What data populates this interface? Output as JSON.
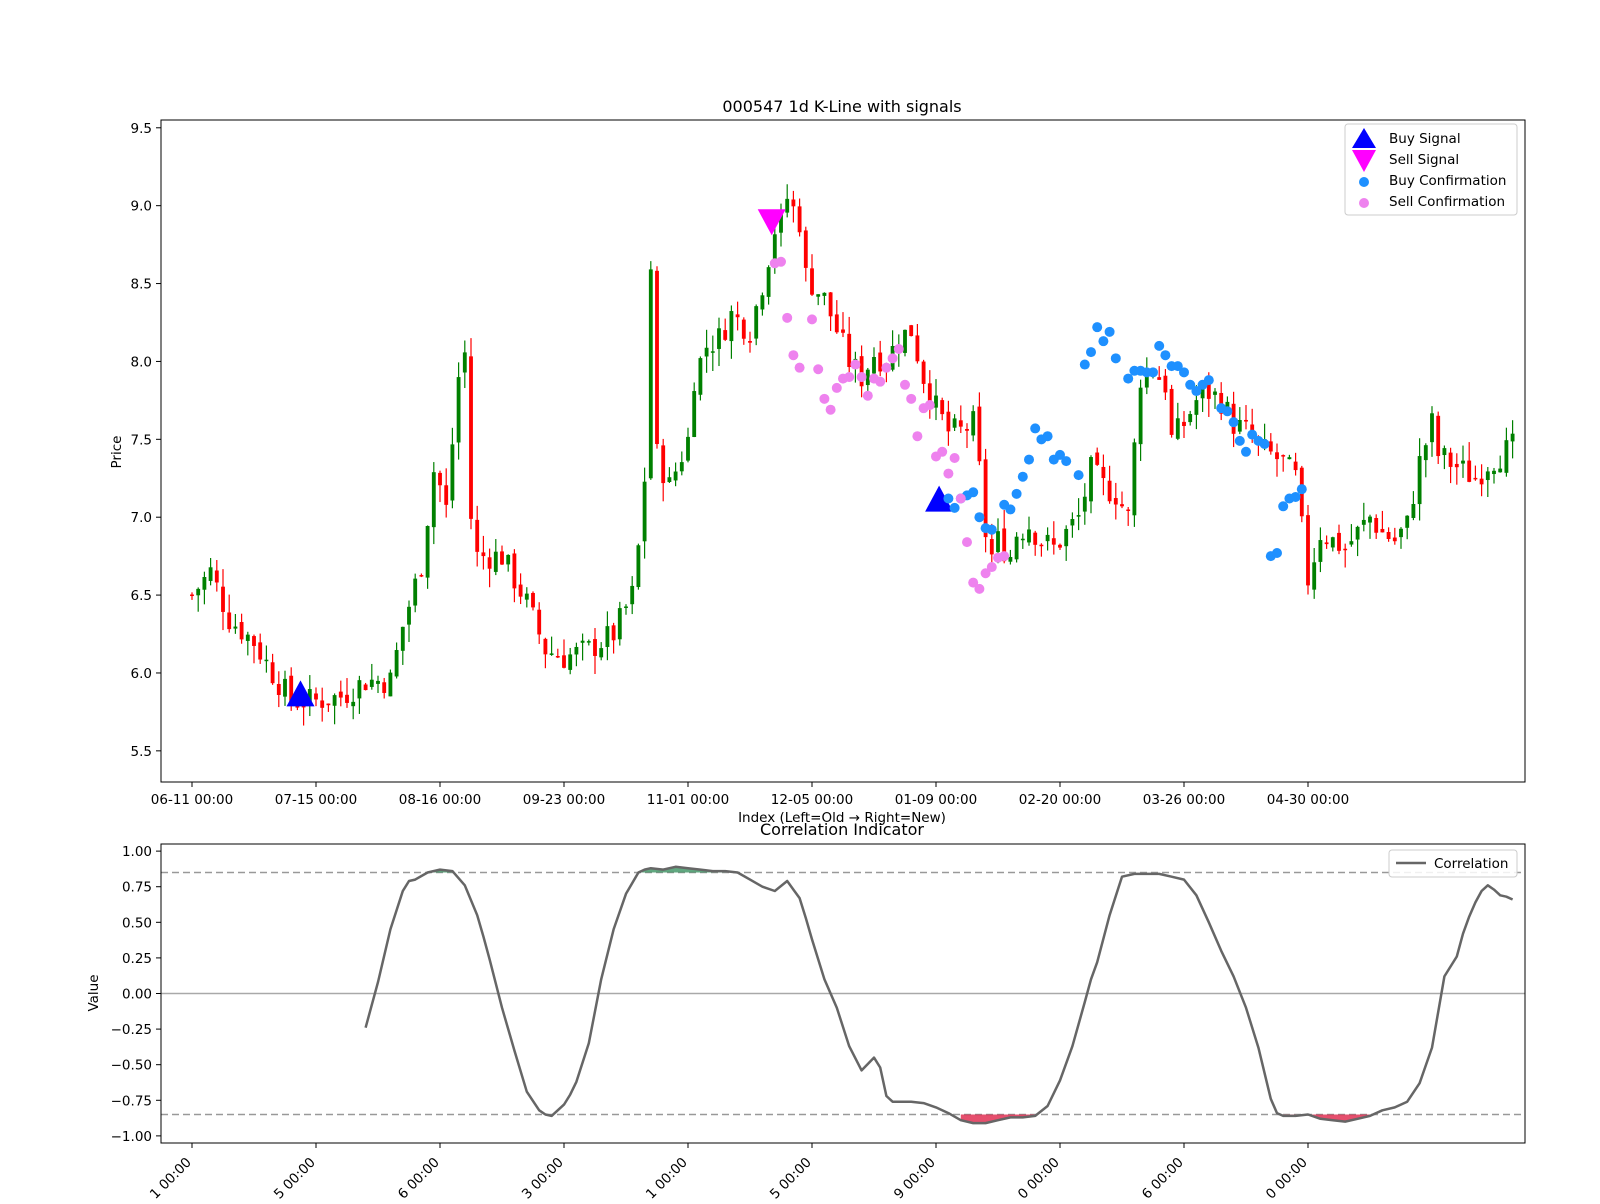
{
  "chart_data": [
    {
      "type": "candlestick",
      "title": "000547 1d K-Line with signals",
      "xlabel": "Index (Left=Old → Right=New)",
      "ylabel": "Price",
      "ylim": [
        5.3,
        9.55
      ],
      "y_ticks": [
        5.5,
        6.0,
        6.5,
        7.0,
        7.5,
        8.0,
        8.5,
        9.0,
        9.5
      ],
      "y_tick_labels": [
        "5.5",
        "6.0",
        "6.5",
        "7.0",
        "7.5",
        "8.0",
        "8.5",
        "9.0",
        "9.5"
      ],
      "xlim": [
        -5,
        215
      ],
      "x_ticks": [
        0,
        20,
        40,
        60,
        80,
        100,
        120,
        140,
        160,
        180
      ],
      "x_tick_labels": [
        "06-11 00:00",
        "07-15 00:00",
        "08-16 00:00",
        "09-23 00:00",
        "11-01 00:00",
        "12-05 00:00",
        "01-09 00:00",
        "02-20 00:00",
        "03-26 00:00",
        "04-30 00:00"
      ],
      "up_color": "#008000",
      "down_color": "#ff0000",
      "price_path": [
        [
          0,
          6.5
        ],
        [
          3,
          6.65
        ],
        [
          6,
          6.35
        ],
        [
          10,
          6.2
        ],
        [
          13,
          6.0
        ],
        [
          16,
          5.82
        ],
        [
          20,
          5.82
        ],
        [
          24,
          5.85
        ],
        [
          28,
          5.95
        ],
        [
          32,
          5.95
        ],
        [
          34,
          6.3
        ],
        [
          37,
          6.7
        ],
        [
          39,
          7.3
        ],
        [
          40,
          7.2
        ],
        [
          41,
          7.05
        ],
        [
          43,
          7.9
        ],
        [
          44,
          8.05
        ],
        [
          45,
          7.0
        ],
        [
          46,
          6.75
        ],
        [
          50,
          6.75
        ],
        [
          54,
          6.45
        ],
        [
          57,
          6.15
        ],
        [
          60,
          6.1
        ],
        [
          64,
          6.15
        ],
        [
          68,
          6.25
        ],
        [
          71,
          6.5
        ],
        [
          72,
          6.8
        ],
        [
          73,
          7.25
        ],
        [
          74,
          8.6
        ],
        [
          75,
          7.4
        ],
        [
          77,
          7.2
        ],
        [
          80,
          7.5
        ],
        [
          81,
          7.9
        ],
        [
          83,
          8.1
        ],
        [
          85,
          8.15
        ],
        [
          87,
          8.3
        ],
        [
          90,
          8.2
        ],
        [
          92,
          8.5
        ],
        [
          94,
          8.85
        ],
        [
          95,
          8.9
        ],
        [
          96,
          9.05
        ],
        [
          98,
          8.9
        ],
        [
          99,
          8.55
        ],
        [
          102,
          8.4
        ],
        [
          104,
          8.2
        ],
        [
          106,
          8.0
        ],
        [
          108,
          7.9
        ],
        [
          110,
          8.05
        ],
        [
          112,
          8.0
        ],
        [
          114,
          8.15
        ],
        [
          116,
          8.2
        ],
        [
          118,
          7.9
        ],
        [
          120,
          7.7
        ],
        [
          122,
          7.55
        ],
        [
          124,
          7.55
        ],
        [
          126,
          7.6
        ],
        [
          127,
          7.3
        ],
        [
          128,
          6.9
        ],
        [
          129,
          6.75
        ],
        [
          130,
          6.85
        ],
        [
          132,
          6.75
        ],
        [
          133,
          6.9
        ],
        [
          135,
          6.95
        ],
        [
          137,
          6.85
        ],
        [
          139,
          6.8
        ],
        [
          141,
          6.9
        ],
        [
          143,
          7.0
        ],
        [
          145,
          7.3
        ],
        [
          147,
          7.2
        ],
        [
          149,
          7.15
        ],
        [
          151,
          7.0
        ],
        [
          153,
          7.9
        ],
        [
          155,
          7.95
        ],
        [
          157,
          7.85
        ],
        [
          158,
          7.5
        ],
        [
          160,
          7.6
        ],
        [
          162,
          7.75
        ],
        [
          164,
          7.8
        ],
        [
          166,
          7.75
        ],
        [
          168,
          7.6
        ],
        [
          170,
          7.55
        ],
        [
          172,
          7.45
        ],
        [
          174,
          7.4
        ],
        [
          176,
          7.35
        ],
        [
          178,
          7.25
        ],
        [
          180,
          6.6
        ],
        [
          182,
          6.9
        ],
        [
          184,
          6.85
        ],
        [
          186,
          6.8
        ],
        [
          188,
          6.9
        ],
        [
          190,
          7.0
        ],
        [
          192,
          6.9
        ],
        [
          194,
          6.85
        ],
        [
          196,
          6.95
        ],
        [
          198,
          7.35
        ],
        [
          200,
          7.6
        ],
        [
          201,
          7.4
        ],
        [
          203,
          7.35
        ],
        [
          205,
          7.3
        ],
        [
          207,
          7.25
        ],
        [
          209,
          7.35
        ],
        [
          211,
          7.4
        ],
        [
          213,
          7.45
        ]
      ],
      "signals": [
        {
          "name": "Buy Signal",
          "marker": "triangle-up",
          "color": "#0000ff",
          "points": [
            [
              17.5,
              5.85
            ],
            [
              120.5,
              7.1
            ]
          ]
        },
        {
          "name": "Sell Signal",
          "marker": "triangle-down",
          "color": "#ff00ff",
          "points": [
            [
              93.5,
              8.9
            ]
          ]
        },
        {
          "name": "Buy Confirmation",
          "marker": "circle",
          "color": "#1e90ff",
          "points": [
            [
              122,
              7.12
            ],
            [
              123,
              7.06
            ],
            [
              124,
              7.12
            ],
            [
              125,
              7.14
            ],
            [
              126,
              7.16
            ],
            [
              127,
              7.0
            ],
            [
              128,
              6.93
            ],
            [
              129,
              6.92
            ],
            [
              131,
              7.08
            ],
            [
              132,
              7.05
            ],
            [
              133,
              7.15
            ],
            [
              134,
              7.26
            ],
            [
              135,
              7.37
            ],
            [
              136,
              7.57
            ],
            [
              137,
              7.5
            ],
            [
              138,
              7.52
            ],
            [
              139,
              7.37
            ],
            [
              140,
              7.4
            ],
            [
              141,
              7.36
            ],
            [
              143,
              7.27
            ],
            [
              144,
              7.98
            ],
            [
              145,
              8.06
            ],
            [
              146,
              8.22
            ],
            [
              147,
              8.13
            ],
            [
              148,
              8.19
            ],
            [
              149,
              8.02
            ],
            [
              151,
              7.89
            ],
            [
              152,
              7.94
            ],
            [
              153,
              7.94
            ],
            [
              154,
              7.93
            ],
            [
              155,
              7.93
            ],
            [
              156,
              8.1
            ],
            [
              157,
              8.04
            ],
            [
              158,
              7.97
            ],
            [
              159,
              7.97
            ],
            [
              160,
              7.93
            ],
            [
              161,
              7.85
            ],
            [
              162,
              7.81
            ],
            [
              163,
              7.85
            ],
            [
              164,
              7.88
            ],
            [
              166,
              7.7
            ],
            [
              167,
              7.68
            ],
            [
              168,
              7.61
            ],
            [
              169,
              7.49
            ],
            [
              170,
              7.42
            ],
            [
              171,
              7.53
            ],
            [
              172,
              7.49
            ],
            [
              173,
              7.47
            ],
            [
              174,
              6.75
            ],
            [
              175,
              6.77
            ],
            [
              176,
              7.07
            ],
            [
              177,
              7.12
            ],
            [
              178,
              7.13
            ],
            [
              179,
              7.18
            ]
          ]
        },
        {
          "name": "Sell Confirmation",
          "marker": "circle",
          "color": "#ee82ee",
          "points": [
            [
              94,
              8.63
            ],
            [
              95,
              8.64
            ],
            [
              96,
              8.28
            ],
            [
              97,
              8.04
            ],
            [
              98,
              7.96
            ],
            [
              100,
              8.27
            ],
            [
              101,
              7.95
            ],
            [
              102,
              7.76
            ],
            [
              103,
              7.69
            ],
            [
              104,
              7.83
            ],
            [
              105,
              7.89
            ],
            [
              106,
              7.9
            ],
            [
              107,
              7.98
            ],
            [
              108,
              7.9
            ],
            [
              109,
              7.78
            ],
            [
              110,
              7.89
            ],
            [
              111,
              7.87
            ],
            [
              112,
              7.96
            ],
            [
              113,
              8.02
            ],
            [
              114,
              8.08
            ],
            [
              115,
              7.85
            ],
            [
              116,
              7.76
            ],
            [
              117,
              7.52
            ],
            [
              118,
              7.7
            ],
            [
              119,
              7.72
            ],
            [
              120,
              7.39
            ],
            [
              121,
              7.42
            ],
            [
              122,
              7.28
            ],
            [
              123,
              7.38
            ],
            [
              124,
              7.12
            ],
            [
              125,
              6.84
            ],
            [
              126,
              6.58
            ],
            [
              127,
              6.54
            ],
            [
              128,
              6.64
            ],
            [
              129,
              6.68
            ],
            [
              130,
              6.74
            ],
            [
              131,
              6.75
            ]
          ]
        }
      ],
      "legend": "top-right",
      "legend_entries": [
        "Buy Signal",
        "Sell Signal",
        "Buy Confirmation",
        "Sell Confirmation"
      ]
    },
    {
      "type": "line",
      "title": "Correlation Indicator",
      "ylabel": "Value",
      "ylim": [
        -1.05,
        1.05
      ],
      "y_ticks": [
        1.0,
        0.75,
        0.5,
        0.25,
        0.0,
        -0.25,
        -0.5,
        -0.75,
        -1.0
      ],
      "y_tick_labels": [
        "1.00",
        "0.75",
        "0.50",
        "0.25",
        "0.00",
        "−0.25",
        "−0.50",
        "−0.75",
        "−1.00"
      ],
      "xlim": [
        -5,
        215
      ],
      "x_ticks": [
        0,
        20,
        40,
        60,
        80,
        100,
        120,
        140,
        160,
        180
      ],
      "x_tick_labels": [
        "1 00:00",
        "5 00:00",
        "6 00:00",
        "3 00:00",
        "1 00:00",
        "5 00:00",
        "9 00:00",
        "0 00:00",
        "6 00:00",
        "0 00:00"
      ],
      "thresholds": [
        0.85,
        -0.85
      ],
      "zero_line": 0.0,
      "positive_fill_color": "#2e8b57",
      "negative_fill_color": "#dc143c",
      "legend": "top-right",
      "series": [
        {
          "name": "Correlation",
          "color": "#666666",
          "x": [
            28,
            30,
            32,
            34,
            35,
            36,
            38,
            40,
            42,
            44,
            46,
            47,
            48,
            50,
            52,
            54,
            56,
            57,
            58,
            60,
            61,
            62,
            64,
            66,
            68,
            70,
            72,
            73,
            74,
            76,
            78,
            80,
            82,
            84,
            86,
            88,
            90,
            92,
            94,
            96,
            97,
            98,
            99,
            100,
            102,
            104,
            106,
            108,
            110,
            111,
            112,
            113,
            114,
            116,
            118,
            120,
            122,
            124,
            126,
            128,
            130,
            132,
            134,
            136,
            138,
            140,
            142,
            144,
            145,
            146,
            148,
            150,
            152,
            154,
            156,
            158,
            160,
            162,
            164,
            166,
            168,
            170,
            172,
            174,
            175,
            176,
            178,
            180,
            182,
            184,
            186,
            188,
            190,
            192,
            194,
            196,
            198,
            200,
            201,
            202,
            204,
            205,
            206,
            207,
            208,
            209,
            210,
            211,
            212,
            213
          ],
          "values": [
            -0.24,
            0.08,
            0.45,
            0.72,
            0.79,
            0.8,
            0.85,
            0.87,
            0.86,
            0.76,
            0.55,
            0.4,
            0.24,
            -0.1,
            -0.4,
            -0.69,
            -0.82,
            -0.85,
            -0.86,
            -0.78,
            -0.71,
            -0.62,
            -0.35,
            0.1,
            0.45,
            0.7,
            0.85,
            0.87,
            0.88,
            0.87,
            0.89,
            0.88,
            0.87,
            0.86,
            0.86,
            0.85,
            0.8,
            0.75,
            0.72,
            0.79,
            0.73,
            0.67,
            0.53,
            0.38,
            0.1,
            -0.1,
            -0.37,
            -0.54,
            -0.45,
            -0.52,
            -0.72,
            -0.76,
            -0.76,
            -0.76,
            -0.77,
            -0.8,
            -0.84,
            -0.89,
            -0.91,
            -0.91,
            -0.89,
            -0.87,
            -0.87,
            -0.86,
            -0.79,
            -0.61,
            -0.37,
            -0.06,
            0.1,
            0.22,
            0.55,
            0.82,
            0.84,
            0.84,
            0.84,
            0.82,
            0.8,
            0.69,
            0.5,
            0.3,
            0.12,
            -0.1,
            -0.38,
            -0.74,
            -0.84,
            -0.86,
            -0.86,
            -0.85,
            -0.88,
            -0.89,
            -0.9,
            -0.88,
            -0.86,
            -0.82,
            -0.8,
            -0.76,
            -0.63,
            -0.38,
            -0.13,
            0.12,
            0.26,
            0.42,
            0.54,
            0.64,
            0.72,
            0.76,
            0.73,
            0.69,
            0.68,
            0.66
          ]
        }
      ]
    }
  ]
}
